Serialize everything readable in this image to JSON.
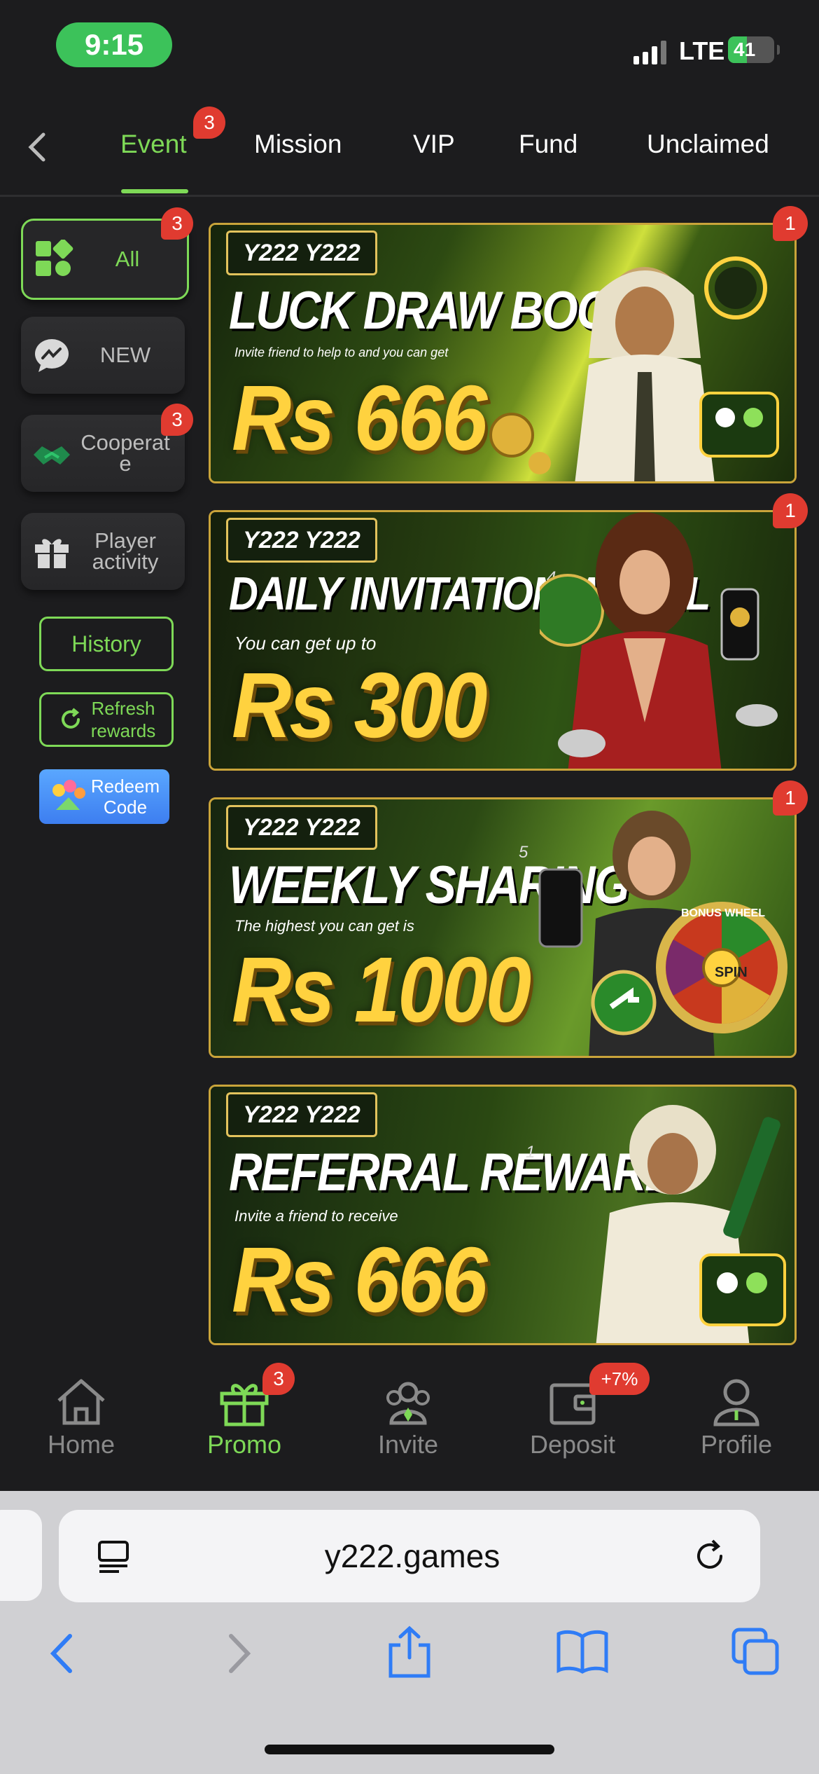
{
  "status_bar": {
    "time": "9:15",
    "network": "LTE",
    "battery": "41",
    "battery_level": 0.41
  },
  "tabs": [
    {
      "label": "Event",
      "badge": "3",
      "active": true
    },
    {
      "label": "Mission"
    },
    {
      "label": "VIP"
    },
    {
      "label": "Fund"
    },
    {
      "label": "Unclaimed"
    }
  ],
  "sidebar": {
    "categories": [
      {
        "label": "All",
        "icon": "grid-icon",
        "badge": "3",
        "active": true
      },
      {
        "label": "NEW",
        "icon": "chat-bubble-icon"
      },
      {
        "label": "Cooperat\ne",
        "icon": "handshake-icon",
        "badge": "3"
      },
      {
        "label": "Player\nactivity",
        "icon": "gift-box-icon"
      }
    ],
    "history_label": "History",
    "refresh_label": "Refresh\nrewards",
    "redeem_label": "Redeem\nCode"
  },
  "banners": [
    {
      "brand": "Y222 Y222",
      "title": "LUCK DRAW BOOST",
      "subtitle": "Invite friend to help to and you can get",
      "amount": "Rs 666",
      "badge": "1"
    },
    {
      "brand": "Y222 Y222",
      "title": "DAILY INVITATION WHEEL",
      "number": "4",
      "subtitle": "You can get up to",
      "amount": "Rs 300",
      "badge": "1"
    },
    {
      "brand": "Y222 Y222",
      "title": "WEEKLY SHARING",
      "number": "5",
      "subtitle": "The highest you can get is",
      "amount": "Rs 1000",
      "badge": "1",
      "wheel_text": "BONUS WHEEL",
      "spin": "SPIN"
    },
    {
      "brand": "Y222 Y222",
      "title": "REFERRAL REWARD",
      "number": "1",
      "subtitle": "Invite a friend to receive",
      "amount": "Rs 666"
    }
  ],
  "bottom_nav": [
    {
      "label": "Home",
      "icon": "home-icon"
    },
    {
      "label": "Promo",
      "icon": "gift-icon",
      "badge": "3",
      "active": true
    },
    {
      "label": "Invite",
      "icon": "invite-icon"
    },
    {
      "label": "Deposit",
      "icon": "wallet-icon",
      "badge": "+7%"
    },
    {
      "label": "Profile",
      "icon": "profile-icon"
    }
  ],
  "browser": {
    "url": "y222.games"
  },
  "colors": {
    "accent": "#7ed957",
    "badge": "#e03b30",
    "gold": "#ffd23f",
    "background": "#1c1c1e"
  }
}
